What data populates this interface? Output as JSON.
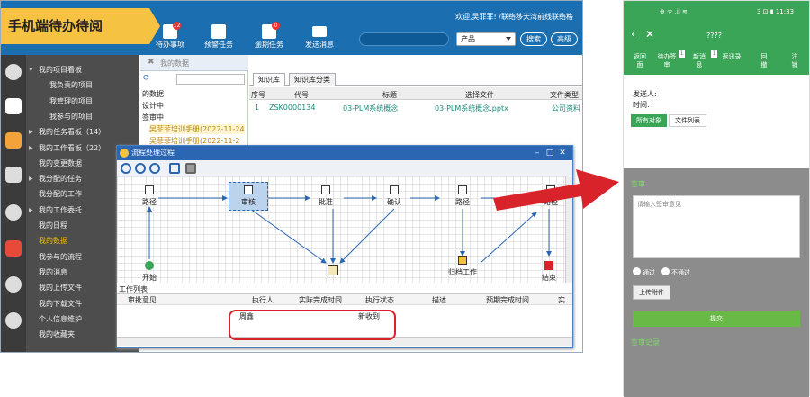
{
  "app": {
    "title": "手机端待办待阅",
    "welcome": "欢迎,吴菲菲! /联络移天湾前线联络格",
    "toolbar": [
      {
        "label": "待办事项",
        "badge": "12",
        "icon": "todo-icon"
      },
      {
        "label": "预警任务",
        "badge": "",
        "icon": "warning-doc-icon"
      },
      {
        "label": "逾期任务",
        "badge": "0",
        "icon": "overdue-icon"
      },
      {
        "label": "发送消息",
        "badge": "",
        "icon": "mail-icon"
      }
    ],
    "search": {
      "placeholder": "",
      "product": "产品",
      "search_btn": "搜索",
      "advanced_btn": "高级"
    }
  },
  "nav": {
    "items": [
      {
        "label": "我的项目看板",
        "type": "down",
        "hl": false
      },
      {
        "label": "我负责的项目",
        "type": "sub",
        "hl": false
      },
      {
        "label": "我管理的项目",
        "type": "sub",
        "hl": false
      },
      {
        "label": "我参与的项目",
        "type": "sub",
        "hl": false
      },
      {
        "label": "我的任务看板（14）",
        "type": "arrow",
        "hl": false
      },
      {
        "label": "我的工作看板（22）",
        "type": "arrow",
        "hl": false
      },
      {
        "label": "我的变更数据",
        "type": "plain",
        "hl": false
      },
      {
        "label": "我分配的任务",
        "type": "arrow",
        "hl": false
      },
      {
        "label": "我分配的工作",
        "type": "plain",
        "hl": false
      },
      {
        "label": "我的工作委托",
        "type": "arrow",
        "hl": false
      },
      {
        "label": "我的日程",
        "type": "plain",
        "hl": false
      },
      {
        "label": "我的数据",
        "type": "plain",
        "hl": true
      },
      {
        "label": "我参与的流程",
        "type": "plain",
        "hl": false
      },
      {
        "label": "我的消息",
        "type": "plain",
        "hl": false
      },
      {
        "label": "我的上传文件",
        "type": "plain",
        "hl": false
      },
      {
        "label": "我的下载文件",
        "type": "plain",
        "hl": false
      },
      {
        "label": "个人信息维护",
        "type": "plain",
        "hl": false
      },
      {
        "label": "我的收藏夹",
        "type": "plain",
        "hl": false
      }
    ]
  },
  "tree": {
    "header": "我的数据",
    "nodes": [
      "的数据",
      "设计中",
      "签审中",
      "吴菲菲培训手册(2022-11-24",
      "吴菲菲培训手册(2022-11-2"
    ]
  },
  "grid": {
    "tabs": [
      "知识库",
      "知识库分类"
    ],
    "columns": [
      "序号",
      "代号",
      "标题",
      "选择文件",
      "文件类型"
    ],
    "rows": [
      [
        "1",
        "ZSK0000134",
        "03-PLM系统概念",
        "03-PLM系统概念.pptx",
        "公司资料"
      ]
    ]
  },
  "dialog": {
    "title": "流程处理过程",
    "nodes": [
      "路径",
      "审核",
      "批准",
      "确认",
      "路径",
      "路径",
      "开始",
      "归档工作",
      "结束"
    ],
    "worklist_label": "工作列表",
    "columns": [
      "审批意见",
      "执行人",
      "实际完成时间",
      "执行状态",
      "描述",
      "预期完成时间",
      "实"
    ],
    "rows": [
      [
        "",
        "周鑫",
        "",
        "新收到",
        "",
        "",
        ""
      ]
    ]
  },
  "phone": {
    "status_left": "⊕ ᯤ .il ≋ ",
    "status_right": "3 ⊡ ▮ 11:33",
    "title": "????",
    "menu": [
      {
        "label": "返回\n面",
        "badge": ""
      },
      {
        "label": "待办签\n审",
        "badge": "1"
      },
      {
        "label": "新消\n息",
        "badge": "1"
      },
      {
        "label": "返讯录",
        "badge": ""
      },
      {
        "label": "回\n撤",
        "badge": ""
      },
      {
        "label": "注\n销",
        "badge": ""
      }
    ],
    "sender_label": "发送人:",
    "time_label": "时间:",
    "tabs": [
      "所有对象",
      "文件列表"
    ],
    "sign_title": "签审",
    "sign_placeholder": "请输入签审意见",
    "opt_pass": "通过",
    "opt_fail": "不通过",
    "upload": "上传附件",
    "submit": "提交",
    "record": "签审记录"
  },
  "colors": {
    "blue": "#1b6fb0",
    "yellow": "#f5c242",
    "green": "#3aa457",
    "red": "#d9232a"
  }
}
